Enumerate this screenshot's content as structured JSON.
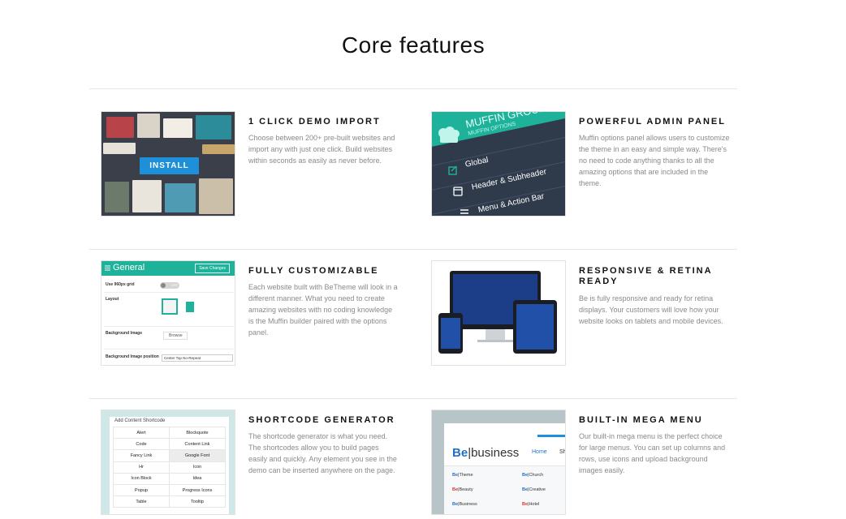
{
  "page": {
    "title": "Core features"
  },
  "features": [
    {
      "title": "1 CLICK DEMO IMPORT",
      "description": "Choose between 200+ pre-built websites and import any with just one click. Build websites within seconds as easily as never before.",
      "thumb": {
        "button_label": "INSTALL"
      }
    },
    {
      "title": "POWERFUL ADMIN PANEL",
      "description": "Muffin options panel allows users to customize the theme in an easy and simple way. There's no need to code anything thanks to all the amazing options that are included in the theme.",
      "thumb": {
        "logo": "MUFFIN GROUP",
        "logo_sub": "MUFFIN OPTIONS",
        "menu": [
          "Global",
          "Header & Subheader",
          "Menu & Action Bar"
        ]
      }
    },
    {
      "title": "FULLY CUSTOMIZABLE",
      "description": "Each website built with BeTheme will look in a different manner. What you need to create amazing websites with no coding knowledge is the Muffin builder paired with the options panel.",
      "thumb": {
        "header": "General",
        "save_label": "Save Changes",
        "rows": [
          "Use 960px grid",
          "Layout",
          "Background Image",
          "Background Image position"
        ],
        "toggle_label": "OFF",
        "browse_label": "Browse",
        "select_value": "Center Top No-Repeat"
      }
    },
    {
      "title": "RESPONSIVE & RETINA READY",
      "description": "Be is fully responsive and ready for retina displays. Your customers will love how your website looks on tablets and mobile devices.",
      "thumb": {}
    },
    {
      "title": "SHORTCODE GENERATOR",
      "description": "The shortcode generator is what you need. The shortcodes allow you to build pages easily and quickly. Any element you see in the demo can be inserted anywhere on the page.",
      "thumb": {
        "header": "Add Content Shortcode",
        "cells": [
          [
            "Alert",
            "Blockquote"
          ],
          [
            "Code",
            "Content Link"
          ],
          [
            "Fancy Link",
            "Google Font"
          ],
          [
            "Hr",
            "Icon"
          ],
          [
            "Icon Block",
            "Idea"
          ],
          [
            "Popup",
            "Progress Icons"
          ],
          [
            "Table",
            "Tooltip"
          ]
        ]
      }
    },
    {
      "title": "BUILT-IN MEGA MENU",
      "description": "Our built-in mega menu is the perfect choice for large menus. You can set up columns and rows, use icons and upload background images easily.",
      "thumb": {
        "brand_be": "Be",
        "brand_rest": "|business",
        "home": "Home",
        "sh": "Sh",
        "items": [
          [
            "Be",
            "|Theme",
            "Be",
            "|Church"
          ],
          [
            "Be",
            "|Beauty",
            "Be",
            "|Creative"
          ],
          [
            "Be",
            "|Business",
            "Be",
            "|Hotel"
          ]
        ]
      }
    }
  ]
}
